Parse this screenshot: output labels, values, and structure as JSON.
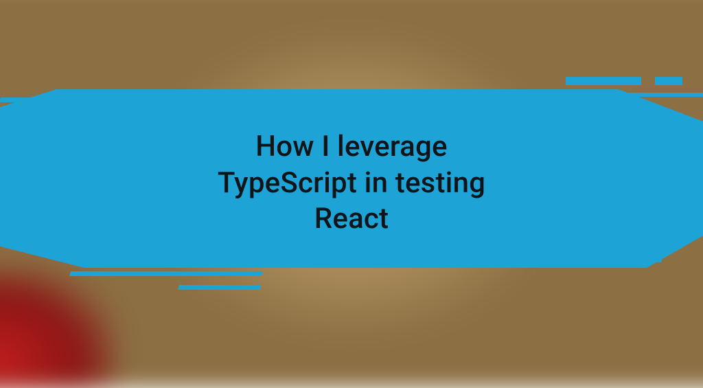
{
  "banner": {
    "title_line1": "How I leverage",
    "title_line2": "TypeScript in testing",
    "title_line3": "React",
    "accent_color": "#1ea3d6"
  }
}
